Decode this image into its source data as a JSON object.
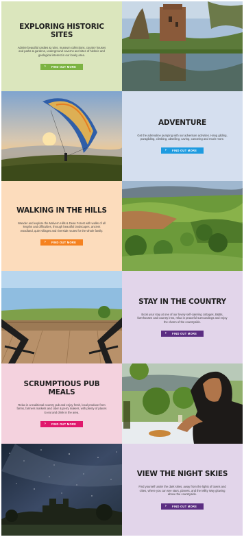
{
  "colors": {
    "historic_bg": "#dbe6bd",
    "adventure_bg": "#d5dfef",
    "hills_bg": "#fcdcbc",
    "country_bg": "#e2d5ea",
    "pub_bg": "#f4d2de",
    "night_bg": "#e2d5ea",
    "btn_green": "#7cb342",
    "btn_blue": "#1e9be0",
    "btn_orange": "#f58220",
    "btn_purple": "#5b2d82",
    "btn_pink": "#e0186c"
  },
  "sections": [
    {
      "title": "EXPLORING HISTORIC SITES",
      "body": "Admire beautiful castles & ruins, museum collections, country houses and parks & gardens, underground caverns and sites of historic and geological interest in our lovely area.",
      "button": "FIND OUT MORE",
      "icon": "chevron-right-icon"
    },
    {
      "title": "ADVENTURE",
      "body": "Get the adrenaline pumping with our adventure activities. Hang gliding, paragliding, climbing, abseiling, caving, canoeing and much more.",
      "button": "FIND OUT MORE",
      "icon": "chevron-right-icon"
    },
    {
      "title": "WALKING IN THE HILLS",
      "body": "Wander and explore the Malvern Hills & Dean Forest with walks of all lengths and difficulties, through beautiful landscapes, ancient woodland, quiet villages and riverside routes for the whole family.",
      "button": "FIND OUT MORE",
      "icon": "chevron-right-icon"
    },
    {
      "title": "STAY IN THE COUNTRY",
      "body": "Book your stay at one of our lovely self-catering cottages, B&Bs, farmhouses and country inns, relax in peaceful surroundings and enjoy the charm of the countryside.",
      "button": "FIND OUT MORE",
      "icon": "chevron-right-icon"
    },
    {
      "title": "SCRUMPTIOUS PUB MEALS",
      "body": "Relax in a traditional country pub and enjoy fresh, local produce from farms, farmers markets and cider & perry makers, with plenty of places to eat and drink in the area.",
      "button": "FIND OUT MORE",
      "icon": "chevron-right-icon"
    },
    {
      "title": "VIEW THE NIGHT SKIES",
      "body": "Find yourself under the dark skies, away from the lights of towns and cities, where you can see stars, planets, and the Milky Way glowing above the countryside.",
      "button": "FIND OUT MORE",
      "icon": "chevron-right-icon"
    }
  ],
  "photos": [
    "castle-ruin-reflection-photo",
    "paraglider-sunset-photo",
    "rolling-hills-valley-photo",
    "deck-chairs-countryside-photo",
    "woman-pub-meal-photo",
    "night-sky-castle-photo"
  ]
}
